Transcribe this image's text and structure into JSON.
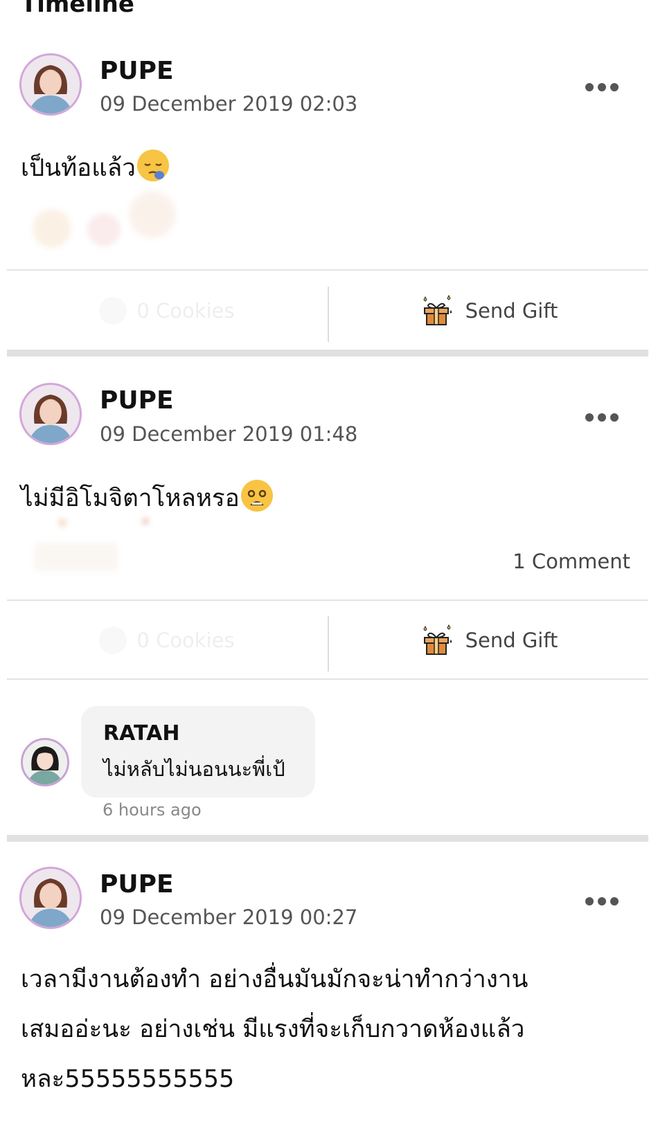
{
  "page": {
    "title": "Timeline"
  },
  "posts": [
    {
      "author": "PUPE",
      "date": "09 December 2019 02:03",
      "text": "เป็นท้อแล้ว",
      "emoji": "sleepy-face-emoji",
      "cookies_label": "0 Cookies",
      "gift_label": "Send Gift"
    },
    {
      "author": "PUPE",
      "date": "09 December 2019 01:48",
      "text": "ไม่มีอิโมจิตาโหลหรอ",
      "emoji": "anguished-face-emoji",
      "comment_count": "1 Comment",
      "cookies_label": "0 Cookies",
      "gift_label": "Send Gift",
      "comment": {
        "author": "RATAH",
        "text": "ไม่หลับไม่นอนนะพี่เป้",
        "time": "6 hours ago"
      }
    },
    {
      "author": "PUPE",
      "date": "09 December 2019 00:27",
      "text_lines": [
        "เวลามีงานต้องทำ อย่างอื่นมันมักจะน่าทำกว่างาน",
        "เสมออ่ะนะ อย่างเช่น มีแรงที่จะเก็บกวาดห้องแล้ว",
        "หละ55555555555"
      ]
    }
  ],
  "colors": {
    "avatar_border": "#d3a6d9",
    "divider": "#e1e1e1",
    "text_secondary": "#555555",
    "bubble": "#f3f3f3"
  }
}
